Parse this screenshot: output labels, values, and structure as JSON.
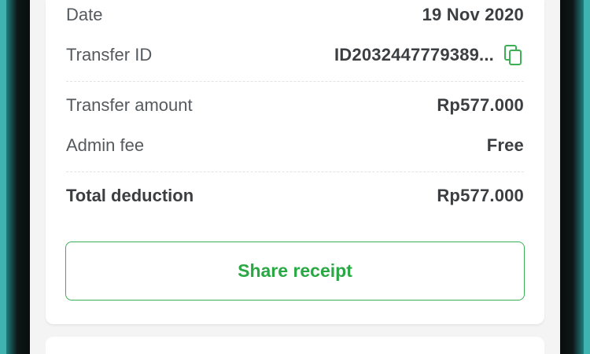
{
  "receipt": {
    "date": {
      "label": "Date",
      "value": "19 Nov 2020"
    },
    "transfer_id": {
      "label": "Transfer ID",
      "value": "ID2032447779389..."
    },
    "transfer_amount": {
      "label": "Transfer amount",
      "value": "Rp577.000"
    },
    "admin_fee": {
      "label": "Admin fee",
      "value": "Free"
    },
    "total_deduction": {
      "label": "Total deduction",
      "value": "Rp577.000"
    }
  },
  "share_button": {
    "label": "Share receipt"
  },
  "icons": {
    "copy": "copy-icon"
  },
  "colors": {
    "accent": "#2aa844",
    "text_dark": "#3c3f42",
    "text_muted": "#555a5e"
  }
}
